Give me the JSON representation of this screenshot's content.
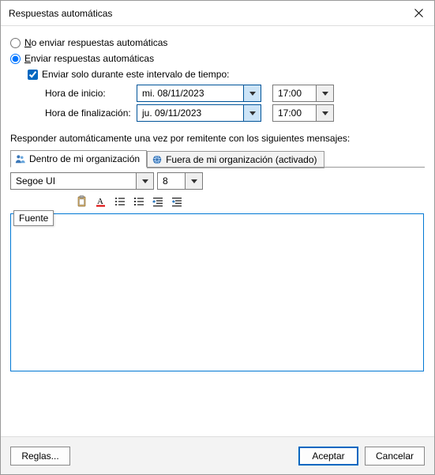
{
  "title": "Respuestas automáticas",
  "radios": {
    "no_send": "No enviar respuestas automáticas",
    "send": "Enviar respuestas automáticas"
  },
  "checkbox": {
    "only_range": "Enviar solo durante este intervalo de tiempo:"
  },
  "labels": {
    "start": "Hora de inicio:",
    "end": "Hora de finalización:",
    "respond": "Responder automáticamente una vez por remitente con los siguientes mensajes:"
  },
  "dates": {
    "start_date": "mi. 08/11/2023",
    "start_time": "17:00",
    "end_date": "ju. 09/11/2023",
    "end_time": "17:00"
  },
  "tabs": {
    "inside": "Dentro de mi organización",
    "outside": "Fuera de mi organización (activado)"
  },
  "editor": {
    "font": "Segoe UI",
    "size": "8",
    "tooltip": "Fuente"
  },
  "buttons": {
    "rules": "Reglas...",
    "ok": "Aceptar",
    "cancel": "Cancelar"
  }
}
